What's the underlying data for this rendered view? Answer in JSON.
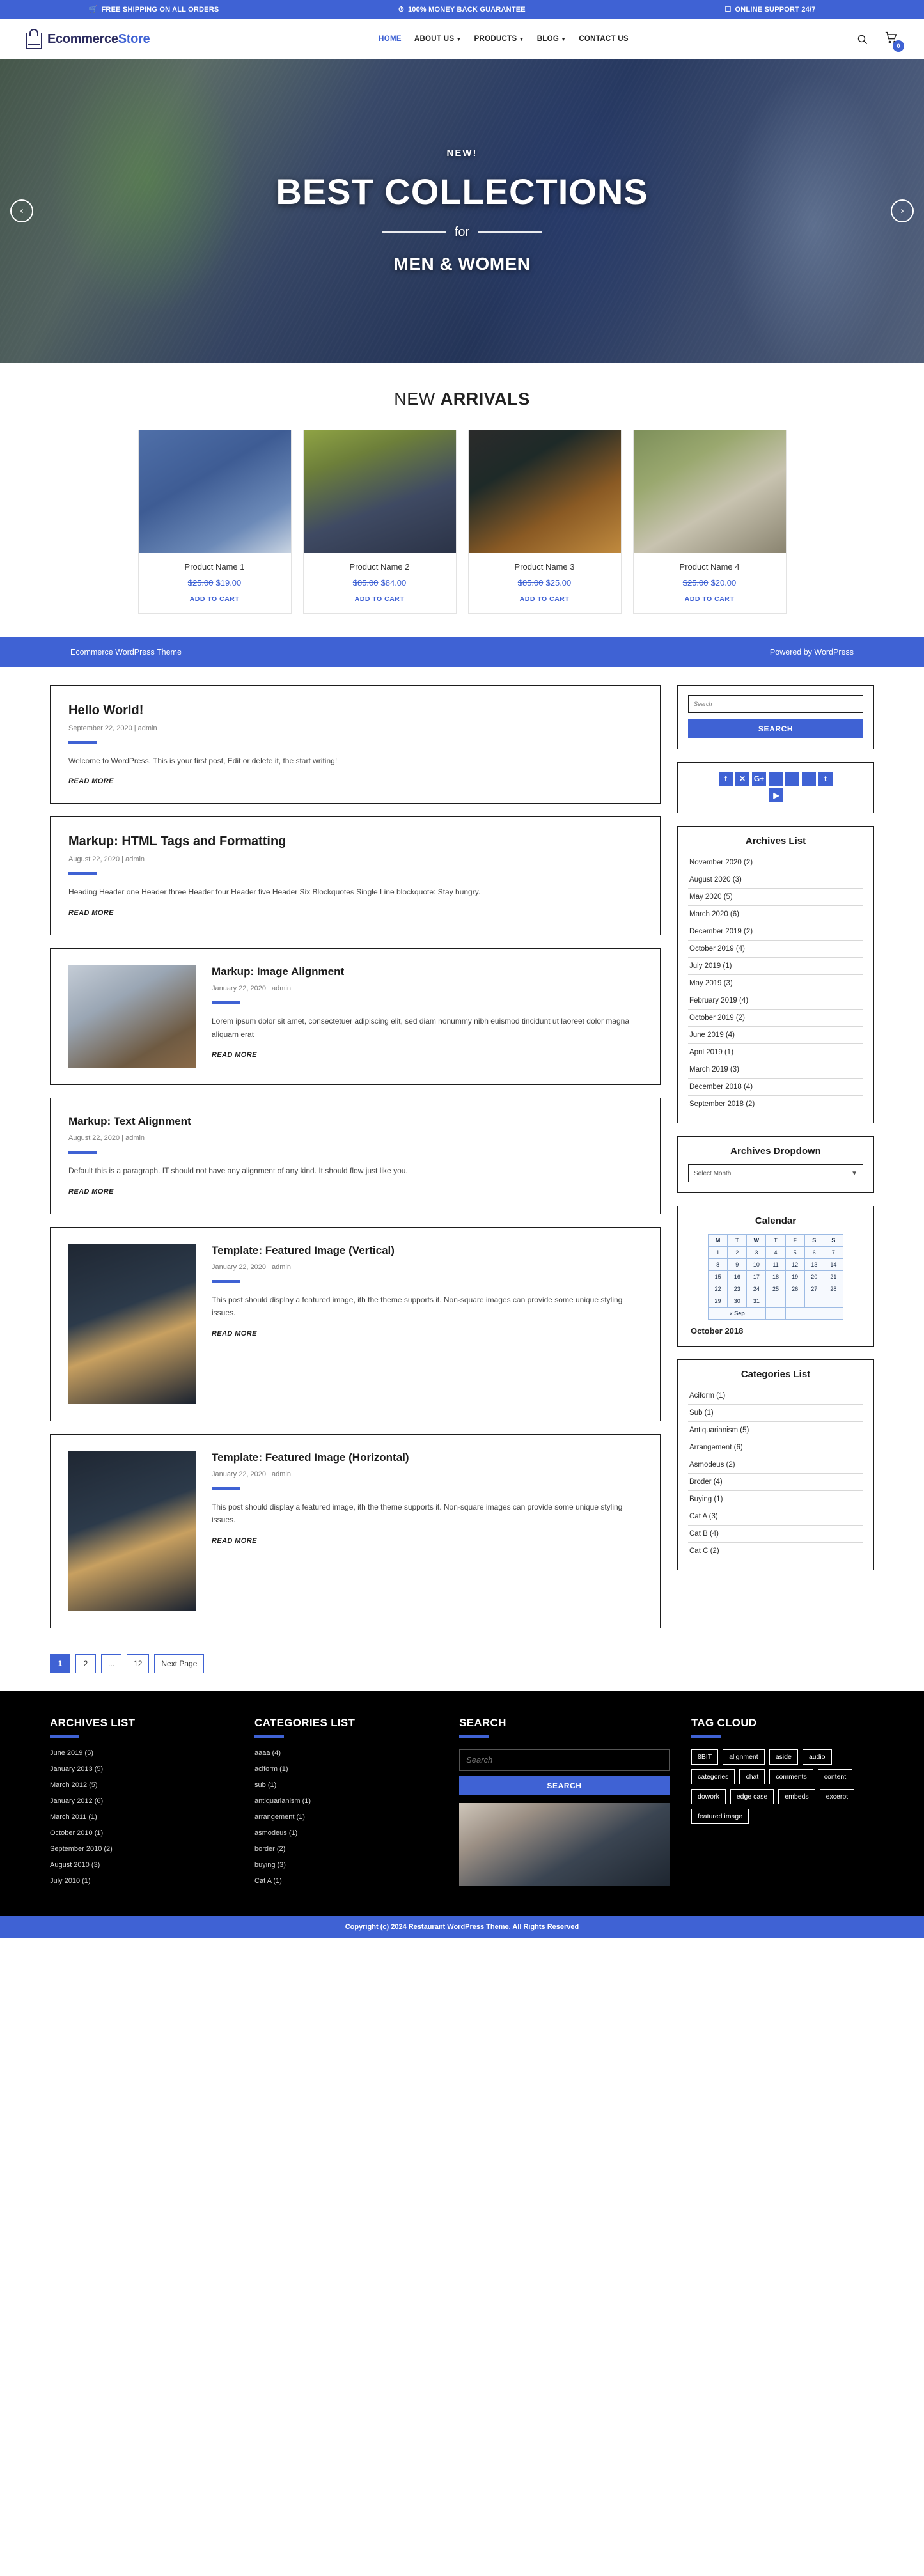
{
  "topbar": {
    "items": [
      {
        "icon": "cart-icon",
        "glyph": "Ὥ2",
        "label": "FREE SHIPPING ON ALL ORDERS"
      },
      {
        "icon": "clock-icon",
        "glyph": "◴",
        "label": "100% MONEY BACK GUARANTEE"
      },
      {
        "icon": "support-icon",
        "glyph": "▣",
        "label": "ONLINE SUPPORT 24/7"
      }
    ]
  },
  "header": {
    "logo_main": "Ecommerce",
    "logo_accent": "Store",
    "nav": [
      {
        "label": "HOME",
        "active": true,
        "caret": ""
      },
      {
        "label": "ABOUT US",
        "active": false,
        "caret": "⌄"
      },
      {
        "label": "PRODUCTS",
        "active": false,
        "caret": "⌄"
      },
      {
        "label": "BLOG",
        "active": false,
        "caret": "⌄"
      },
      {
        "label": "CONTACT US",
        "active": false,
        "caret": ""
      }
    ],
    "cart_count": "0"
  },
  "hero": {
    "eyebrow": "NEW!",
    "title": "BEST COLLECTIONS",
    "connector": "for",
    "subtitle": "MEN & WOMEN",
    "prev": "‹",
    "next": "›"
  },
  "arrivals": {
    "title_light": "NEW ",
    "title_bold": "ARRIVALS",
    "cart_label": "ADD TO CART",
    "products": [
      {
        "name": "Product Name 1",
        "old_price": "$25.00",
        "new_price": "$19.00"
      },
      {
        "name": "Product Name 2",
        "old_price": "$85.00",
        "new_price": "$84.00"
      },
      {
        "name": "Product Name 3",
        "old_price": "$85.00",
        "new_price": "$25.00"
      },
      {
        "name": "Product Name 4",
        "old_price": "$25.00",
        "new_price": "$20.00"
      }
    ]
  },
  "promo": {
    "left": "Ecommerce WordPress Theme",
    "right": "Powered by WordPress"
  },
  "posts": [
    {
      "title": "Hello World!",
      "meta": "September 22, 2020 | admin",
      "text": "Welcome to WordPress. This is your first post, Edit or delete it, the start writing!",
      "read_more": "READ MORE"
    },
    {
      "title": "Markup: HTML Tags and Formatting",
      "meta": "August 22, 2020 | admin",
      "text": "Heading Header one Header three Header four Header five Header Six Blockquotes Single Line blockquote: Stay hungry.",
      "read_more": "READ MORE"
    },
    {
      "title": "Markup: Image Alignment",
      "meta": "January 22, 2020 | admin",
      "text": "Lorem ipsum dolor sit amet, consectetuer adipiscing elit, sed diam nonummy nibh euismod tincidunt ut laoreet dolor magna aliquam erat",
      "read_more": "READ MORE"
    },
    {
      "title": "Markup: Text Alignment",
      "meta": "August 22, 2020 | admin",
      "text": "Default this is a paragraph. IT should not have any alignment of any kind. It should flow just like you.",
      "read_more": "READ MORE"
    },
    {
      "title": "Template: Featured Image (Vertical)",
      "meta": "January 22, 2020 | admin",
      "text": "This post should display a featured image, ith the theme supports it. Non-square images can provide some unique styling issues.",
      "read_more": "READ MORE"
    },
    {
      "title": "Template: Featured Image (Horizontal)",
      "meta": "January 22, 2020 | admin",
      "text": "This post should display a featured image, ith the theme supports it. Non-square images can provide some unique styling issues.",
      "read_more": "READ MORE"
    }
  ],
  "sidebar": {
    "search": {
      "placeholder": "Search",
      "button": "SEARCH"
    },
    "social": [
      {
        "name": "facebook-icon",
        "glyph": "f"
      },
      {
        "name": "x-twitter-icon",
        "glyph": "✕"
      },
      {
        "name": "google-plus-icon",
        "glyph": "G+"
      },
      {
        "name": "social-icon-blank-1",
        "glyph": ""
      },
      {
        "name": "social-icon-blank-2",
        "glyph": ""
      },
      {
        "name": "social-icon-blank-3",
        "glyph": ""
      },
      {
        "name": "tumblr-icon",
        "glyph": "t"
      }
    ],
    "social_second": {
      "name": "youtube-icon",
      "glyph": "▶"
    },
    "archives_title": "Archives List",
    "archives": [
      "November 2020 (2)",
      "August 2020 (3)",
      "May 2020 (5)",
      "March 2020 (6)",
      "December 2019 (2)",
      "October 2019 (4)",
      "July 2019 (1)",
      "May 2019 (3)",
      "February 2019 (4)",
      "October 2019 (2)",
      "June 2019 (4)",
      "April 2019 (1)",
      "March 2019 (3)",
      "December 2018 (4)",
      "September 2018 (2)"
    ],
    "dropdown_title": "Archives Dropdown",
    "dropdown_value": "Select Month",
    "calendar": {
      "title": "Calendar",
      "weekdays": [
        "M",
        "T",
        "W",
        "T",
        "F",
        "S",
        "S"
      ],
      "weeks": [
        [
          "1",
          "2",
          "3",
          "4",
          "5",
          "6",
          "7"
        ],
        [
          "8",
          "9",
          "10",
          "11",
          "12",
          "13",
          "14"
        ],
        [
          "15",
          "16",
          "17",
          "18",
          "19",
          "20",
          "21"
        ],
        [
          "22",
          "23",
          "24",
          "25",
          "26",
          "27",
          "28"
        ],
        [
          "29",
          "30",
          "31",
          "",
          "",
          "",
          ""
        ]
      ],
      "prev_link": "« Sep",
      "month_label": "October 2018"
    },
    "categories_title": "Categories List",
    "categories": [
      "Aciform (1)",
      "Sub (1)",
      "Antiquarianism (5)",
      "Arrangement (6)",
      "Asmodeus (2)",
      "Broder (4)",
      "Buying (1)",
      "Cat A (3)",
      "Cat B (4)",
      "Cat C (2)"
    ]
  },
  "pagination": [
    {
      "label": "1",
      "active": true
    },
    {
      "label": "2",
      "active": false
    },
    {
      "label": "...",
      "active": false
    },
    {
      "label": "12",
      "active": false
    },
    {
      "label": "Next Page",
      "active": false
    }
  ],
  "footer": {
    "archives_title": "ARCHIVES LIST",
    "archives": [
      "June 2019 (5)",
      "January  2013 (5)",
      "March 2012 (5)",
      "January  2012 (6)",
      "March  2011 (1)",
      "October 2010 (1)",
      "September 2010 (2)",
      "August 2010 (3)",
      "July 2010 (1)"
    ],
    "categories_title": "CATEGORIES LIST",
    "categories": [
      "aaaa (4)",
      "aciform (1)",
      "sub (1)",
      "antiquarianism (1)",
      "arrangement (1)",
      "asmodeus (1)",
      "border (2)",
      "buying (3)",
      "Cat A (1)"
    ],
    "search_title": "SEARCH",
    "search_placeholder": "Search",
    "search_button": "SEARCH",
    "tag_title": "TAG CLOUD",
    "tags": [
      "8BIT",
      "alignment",
      "aside",
      "audio",
      "categories",
      "chat",
      "comments",
      "content",
      "dowork",
      "edge case",
      "embeds",
      "excerpt",
      "featured image"
    ]
  },
  "copyright": "Copyright (c) 2024 Restaurant WordPress Theme. All Rights Reserved"
}
